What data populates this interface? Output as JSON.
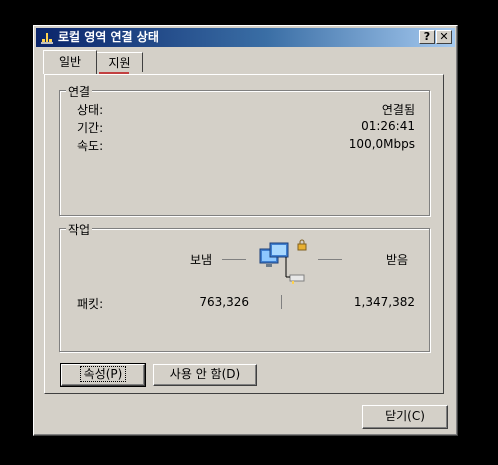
{
  "window": {
    "title": "로컬 영역 연결 상태",
    "help_button": "?",
    "close_button": "✕"
  },
  "tabs": [
    {
      "label": "일반",
      "active": true
    },
    {
      "label": "지원",
      "active": false
    }
  ],
  "connection": {
    "group_label": "연결",
    "rows": [
      {
        "label": "상태:",
        "value": "연결됨"
      },
      {
        "label": "기간:",
        "value": "01:26:41"
      },
      {
        "label": "속도:",
        "value": "100,0Mbps"
      }
    ]
  },
  "activity": {
    "group_label": "작업",
    "sent_label": "보냄",
    "received_label": "받음",
    "packets_label": "패킷:",
    "packets_sent": "763,326",
    "packets_received": "1,347,382"
  },
  "buttons": {
    "properties": "속성(P)",
    "disable": "사용 안 함(D)",
    "close": "닫기(C)"
  },
  "colors": {
    "face": "#d4d0c8",
    "title_start": "#0a246a",
    "title_end": "#a6caf0",
    "underline": "#c24040"
  },
  "icons": [
    "network-connection-icon",
    "network-computers-icon",
    "lock-icon"
  ]
}
